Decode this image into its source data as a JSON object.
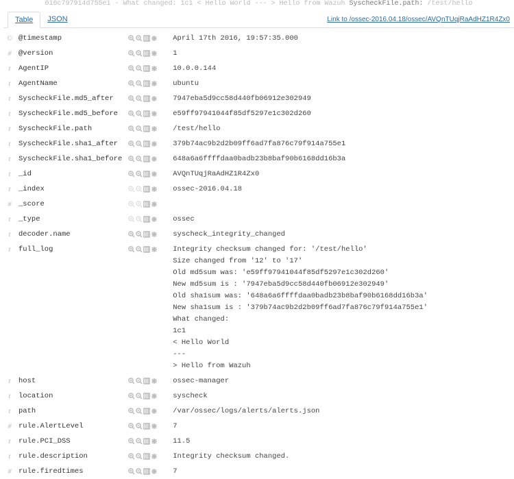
{
  "top_crumb_prefix": "016c797914d755e1 - What changed: 1c1 < Hello World --- > Hello from Wazuh  ",
  "top_crumb_hl": "SyscheckFile.path:",
  "top_crumb_suffix": " /test/hello",
  "tabs": {
    "table": "Table",
    "json": "JSON"
  },
  "link": "Link to /ossec-2016.04.18/ossec/AVQnTUqjRaAdHZ1R4Zx0",
  "rows": [
    {
      "t": "©",
      "name": "@timestamp",
      "val": "April 17th 2016, 19:57:35.000"
    },
    {
      "t": "#",
      "name": "@version",
      "val": "1"
    },
    {
      "t": "t",
      "name": "AgentIP",
      "val": "10.0.0.144"
    },
    {
      "t": "t",
      "name": "AgentName",
      "val": "ubuntu"
    },
    {
      "t": "t",
      "name": "SyscheckFile.md5_after",
      "val": "7947eba5d9cc58d440fb06912e302949"
    },
    {
      "t": "t",
      "name": "SyscheckFile.md5_before",
      "val": "e59ff97941044f85df5297e1c302d260"
    },
    {
      "t": "t",
      "name": "SyscheckFile.path",
      "val": "/test/hello"
    },
    {
      "t": "t",
      "name": "SyscheckFile.sha1_after",
      "val": "379b74ac9b2d2b09ff6ad7fa876c79f914a755e1"
    },
    {
      "t": "t",
      "name": "SyscheckFile.sha1_before",
      "val": "648a6a6ffffdaa0badb23b8baf90b6168dd16b3a"
    },
    {
      "t": "t",
      "name": "_id",
      "val": "AVQnTUqjRaAdHZ1R4Zx0"
    },
    {
      "t": "t",
      "name": "_index",
      "val": "ossec-2016.04.18",
      "faded": true
    },
    {
      "t": "#",
      "name": "_score",
      "val": "",
      "faded": true
    },
    {
      "t": "t",
      "name": "_type",
      "val": "ossec",
      "faded": true
    },
    {
      "t": "t",
      "name": "decoder.name",
      "val": "syscheck_integrity_changed"
    },
    {
      "t": "t",
      "name": "full_log",
      "val": "Integrity checksum changed for: '/test/hello'\nSize changed from '12' to '17'\nOld md5sum was: 'e59ff97941044f85df5297e1c302d260'\nNew md5sum is : '7947eba5d9cc58d440fb06912e302949'\nOld sha1sum was: '648a6a6ffffdaa0badb23b8baf90b6168dd16b3a'\nNew sha1sum is : '379b74ac9b2d2b09ff6ad7fa876c79f914a755e1'\nWhat changed:\n1c1\n< Hello World\n---\n> Hello from Wazuh"
    },
    {
      "t": "t",
      "name": "host",
      "val": "ossec-manager"
    },
    {
      "t": "t",
      "name": "location",
      "val": "syscheck"
    },
    {
      "t": "t",
      "name": "path",
      "val": "/var/ossec/logs/alerts/alerts.json"
    },
    {
      "t": "#",
      "name": "rule.AlertLevel",
      "val": "7"
    },
    {
      "t": "t",
      "name": "rule.PCI_DSS",
      "val": "11.5"
    },
    {
      "t": "t",
      "name": "rule.description",
      "val": "Integrity checksum changed."
    },
    {
      "t": "#",
      "name": "rule.firedtimes",
      "val": "7"
    }
  ]
}
